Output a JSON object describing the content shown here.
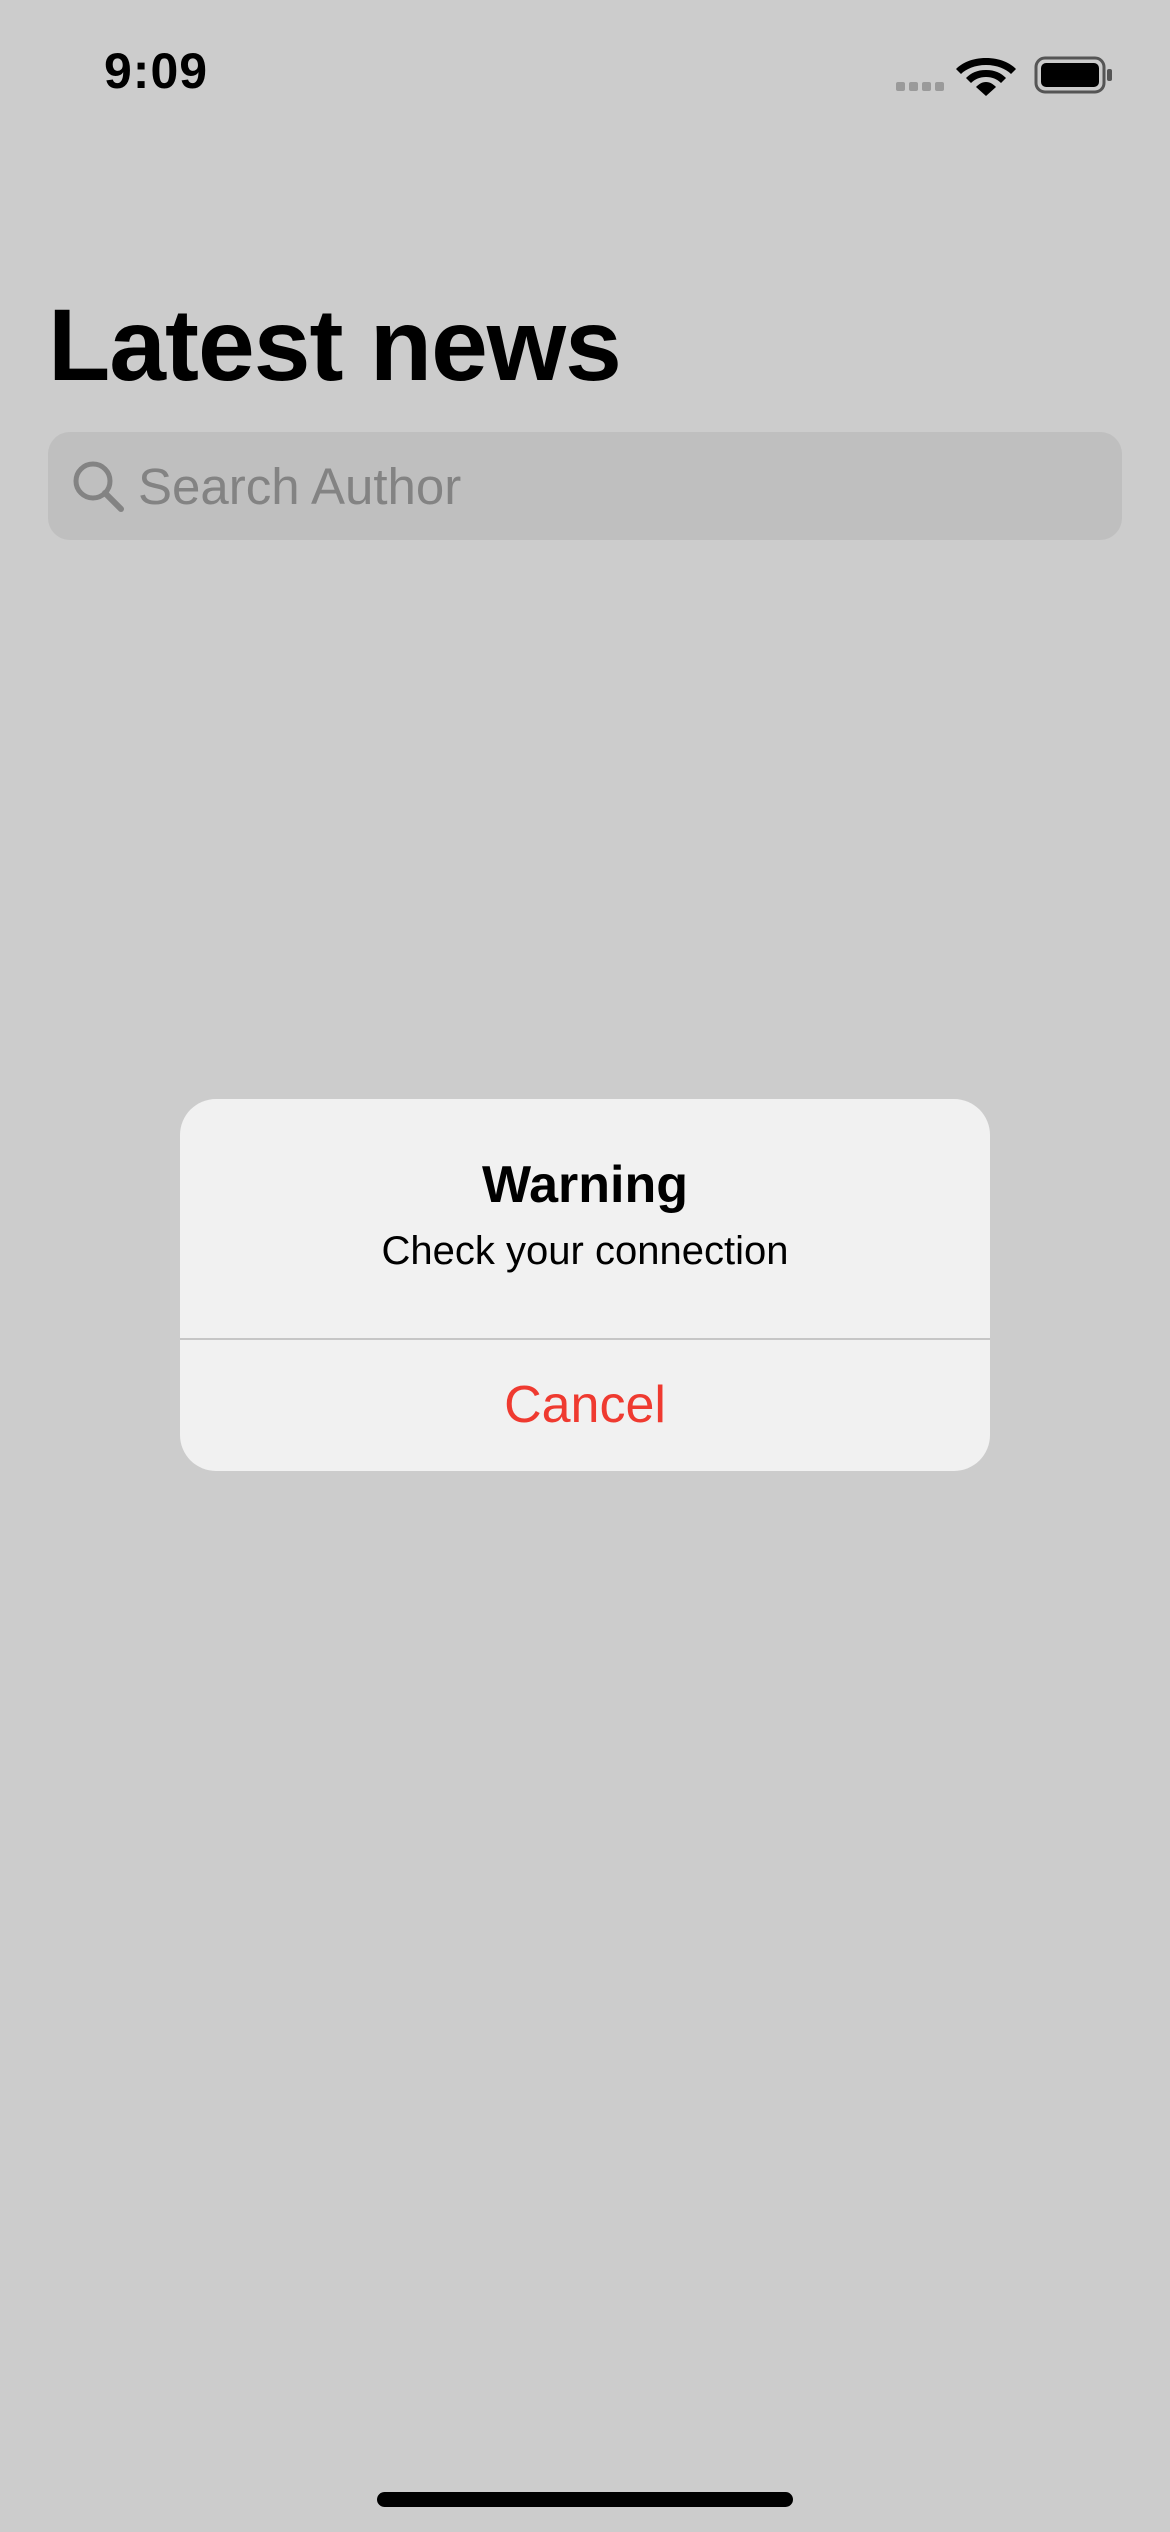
{
  "status_bar": {
    "time": "9:09",
    "icons": [
      "cellular-signal-icon",
      "wifi-icon",
      "battery-icon"
    ]
  },
  "header": {
    "title": "Latest news"
  },
  "search": {
    "placeholder": "Search Author",
    "value": "",
    "icon": "search-icon"
  },
  "alert": {
    "title": "Warning",
    "message": "Check your connection",
    "cancel_label": "Cancel"
  },
  "colors": {
    "background": "#cccccc",
    "alert_background": "#f1f1f1",
    "destructive": "#ef3a30",
    "search_field": "#bfbfbf"
  }
}
